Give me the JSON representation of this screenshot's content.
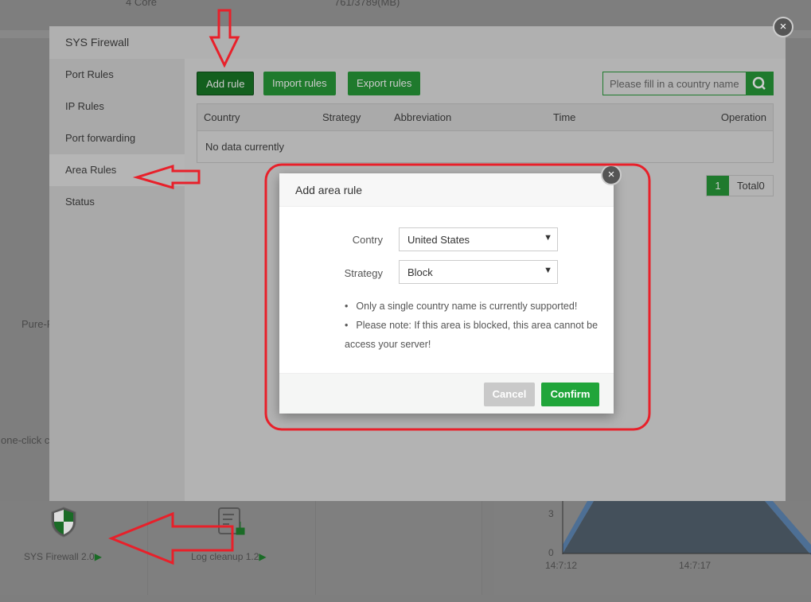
{
  "background": {
    "cpu": "4 Core",
    "memory": "761/3789(MB)",
    "app_partial_1": "Pure-F",
    "app_partial_2": "one-click c",
    "apps": [
      {
        "label": "SYS Firewall 2.0"
      },
      {
        "label": "Log cleanup 1.2"
      }
    ],
    "chart": {
      "y_ticks": [
        "3",
        "0"
      ],
      "x_ticks": [
        "14:7:12",
        "14:7:17"
      ]
    }
  },
  "firewall": {
    "title": "SYS Firewall",
    "sidebar": [
      {
        "label": "Port Rules"
      },
      {
        "label": "IP Rules"
      },
      {
        "label": "Port forwarding"
      },
      {
        "label": "Area Rules",
        "active": true
      },
      {
        "label": "Status"
      }
    ],
    "toolbar": {
      "add": "Add rule",
      "import": "Import rules",
      "export": "Export rules",
      "search_placeholder": "Please fill in a country name"
    },
    "table": {
      "columns": [
        "Country",
        "Strategy",
        "Abbreviation",
        "Time",
        "Operation"
      ],
      "empty": "No data currently"
    },
    "pagination": {
      "page": "1",
      "total": "Total0"
    }
  },
  "dialog": {
    "title": "Add area rule",
    "country_label": "Contry",
    "country_value": "United States",
    "strategy_label": "Strategy",
    "strategy_value": "Block",
    "notes": [
      "Only a single country name is currently supported!",
      "Please note: If this area is blocked, this area cannot be access your server!"
    ],
    "cancel": "Cancel",
    "confirm": "Confirm"
  },
  "colors": {
    "accent": "#20a53a",
    "annotation": "#e8202a"
  }
}
